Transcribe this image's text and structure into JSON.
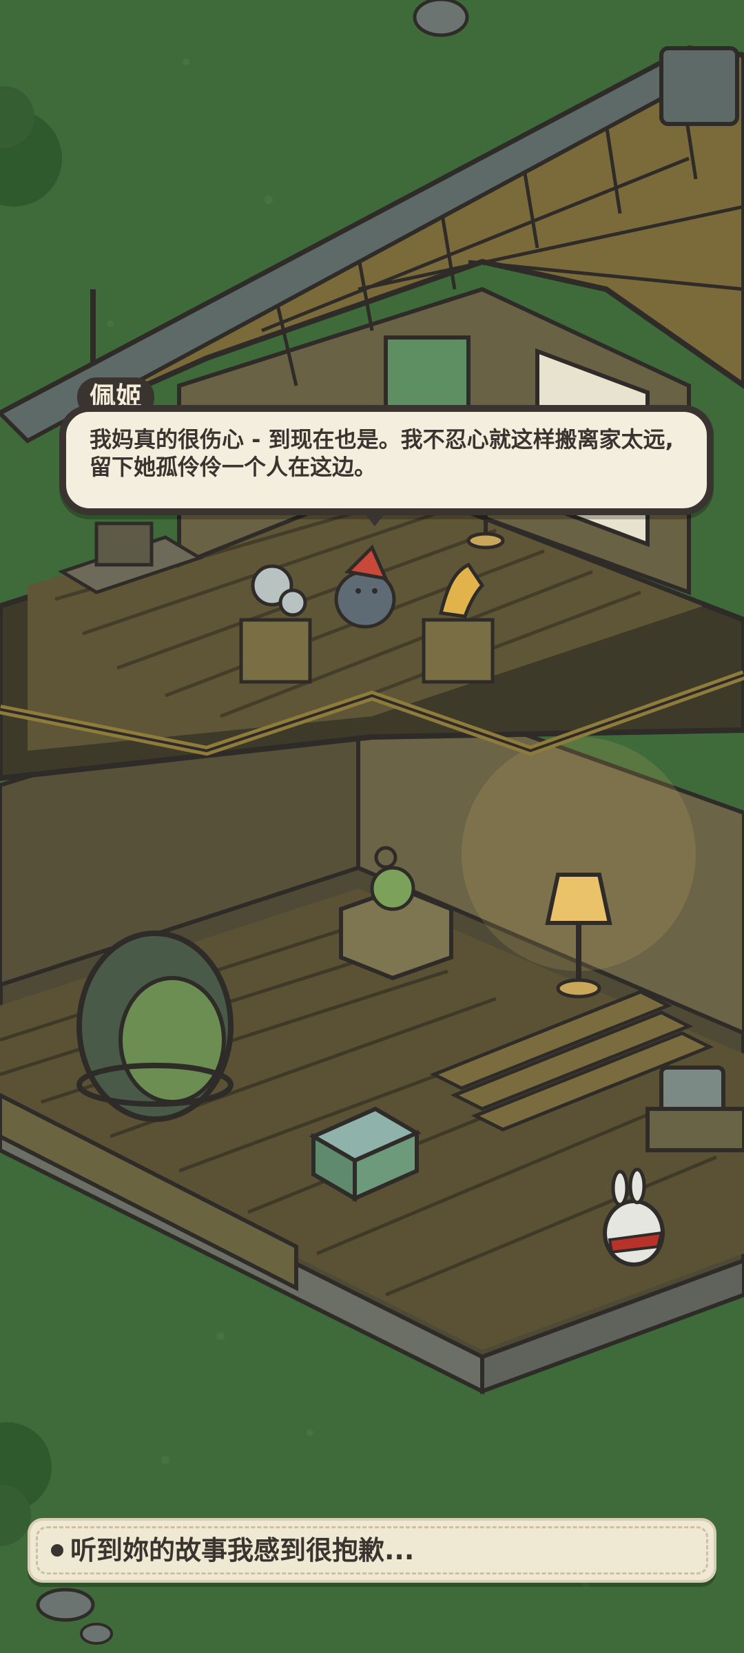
{
  "dialog": {
    "speaker": "佩姬",
    "line": "我妈真的很伤心 - 到现在也是。我不忍心就这样搬离家太远, 留下她孤伶伶一个人在这边。"
  },
  "choices": [
    {
      "label": "听到妳的故事我感到很抱歉..."
    }
  ],
  "colors": {
    "grass": "#3f6b3a",
    "bubble_bg": "#f3eedd",
    "bubble_border": "#3a3430",
    "choice_bg": "#efe8d3"
  }
}
